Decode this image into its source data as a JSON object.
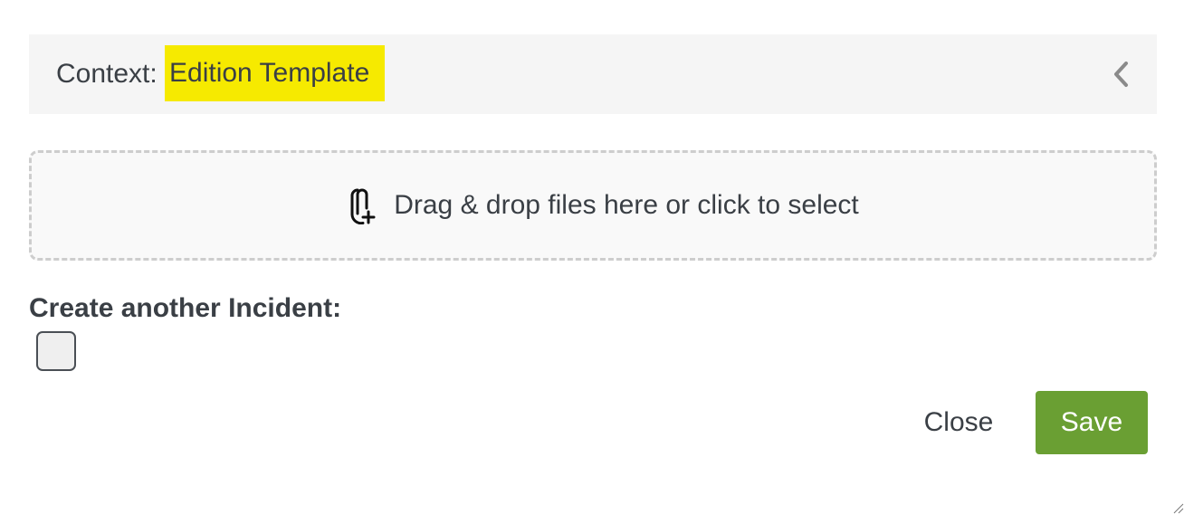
{
  "context": {
    "label": "Context:",
    "value": "Edition Template",
    "highlight_color": "#f6ea00",
    "collapse_icon": "chevron-left-icon"
  },
  "dropzone": {
    "icon": "paperclip-plus-icon",
    "text": "Drag & drop files here or click to select"
  },
  "create_another": {
    "label": "Create another Incident:",
    "checked": false
  },
  "footer": {
    "close_label": "Close",
    "save_label": "Save",
    "save_color": "#6a9f33"
  }
}
